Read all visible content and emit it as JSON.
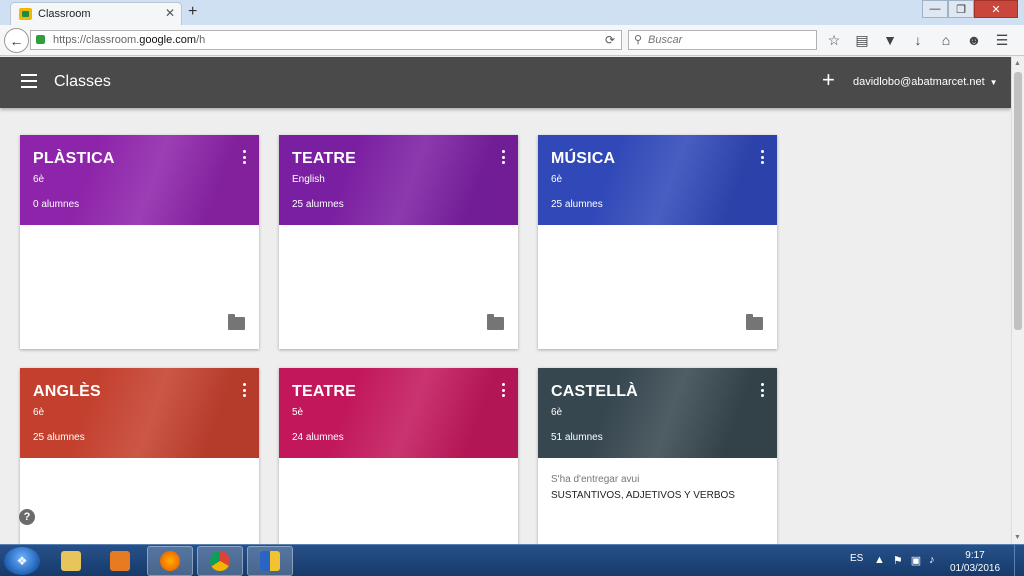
{
  "browser": {
    "tab_title": "Classroom",
    "tab_close": "✕",
    "new_tab": "+",
    "url_prefix": "https://classroom.",
    "url_domain": "google.com",
    "url_suffix": "/h",
    "search_placeholder": "Buscar"
  },
  "app": {
    "title": "Classes",
    "add_label": "+",
    "account": "davidlobo@abatmarcet.net"
  },
  "cards": [
    {
      "name": "PLÀSTICA",
      "section": "6è",
      "students": "0 alumnes",
      "color": "#8e24aa"
    },
    {
      "name": "TEATRE",
      "section": "English",
      "students": "25 alumnes",
      "color": "#7b1fa2"
    },
    {
      "name": "MÚSICA",
      "section": "6è",
      "students": "25 alumnes",
      "color": "#3048b8"
    },
    {
      "name": "ANGLÈS",
      "section": "6è",
      "students": "25 alumnes",
      "color": "#c4402e"
    },
    {
      "name": "TEATRE",
      "section": "5è",
      "students": "24 alumnes",
      "color": "#c2185b"
    },
    {
      "name": "CASTELLÀ",
      "section": "6è",
      "students": "51 alumnes",
      "color": "#37474f",
      "due_label": "S'ha d'entregar avui",
      "due_item": "SUSTANTIVOS, ADJETIVOS Y VERBOS"
    }
  ],
  "help_label": "?",
  "taskbar": {
    "language": "ES",
    "time": "9:17",
    "date": "01/03/2016"
  }
}
